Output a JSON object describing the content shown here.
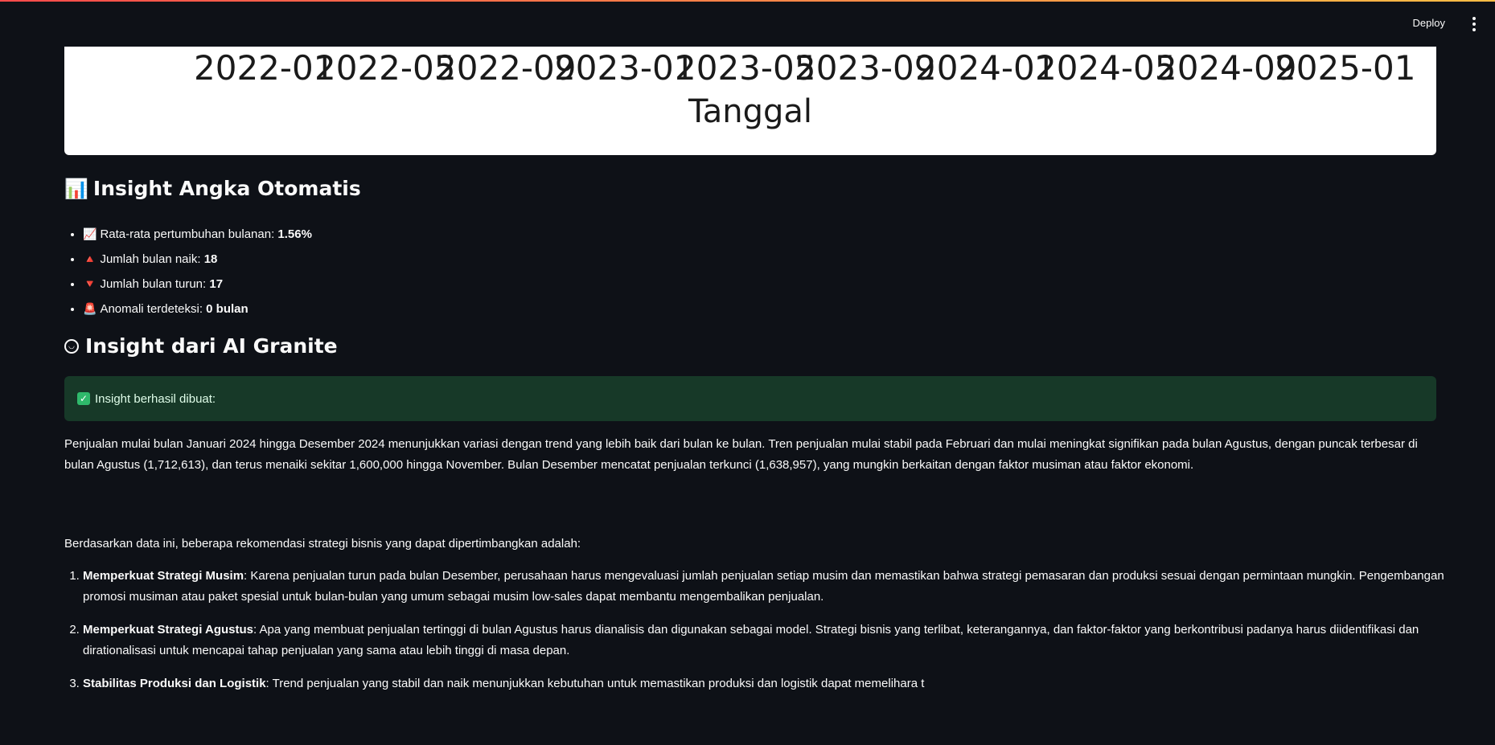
{
  "header": {
    "deploy_label": "Deploy"
  },
  "chart": {
    "tick_labels": [
      "2022-01",
      "2022-05",
      "2022-09",
      "2023-01",
      "2023-05",
      "2023-09",
      "2024-01",
      "2024-05",
      "2024-09",
      "2025-01"
    ],
    "xlabel": "Tanggal"
  },
  "insight_numbers": {
    "title": "Insight Angka Otomatis",
    "items": [
      {
        "emoji": "📈",
        "label": "Rata-rata pertumbuhan bulanan: ",
        "value": "1.56%"
      },
      {
        "emoji": "🔺",
        "label": "Jumlah bulan naik: ",
        "value": "18"
      },
      {
        "emoji": "🔻",
        "label": "Jumlah bulan turun: ",
        "value": "17"
      },
      {
        "emoji": "🚨",
        "label": "Anomali terdeteksi: ",
        "value": "0 bulan"
      }
    ]
  },
  "insight_ai": {
    "title": "Insight dari AI Granite",
    "success_text": "Insight berhasil dibuat:",
    "paragraph1": "Penjualan mulai bulan Januari 2024 hingga Desember 2024 menunjukkan variasi dengan trend yang lebih baik dari bulan ke bulan. Tren penjualan mulai stabil pada Februari dan mulai meningkat signifikan pada bulan Agustus, dengan puncak terbesar di bulan Agustus (1,712,613), dan terus menaiki sekitar 1,600,000 hingga November. Bulan Desember mencatat penjualan terkunci (1,638,957), yang mungkin berkaitan dengan faktor musiman atau faktor ekonomi.",
    "paragraph2": "Berdasarkan data ini, beberapa rekomendasi strategi bisnis yang dapat dipertimbangkan adalah:",
    "recommendations": [
      {
        "title": "Memperkuat Strategi Musim",
        "text": ": Karena penjualan turun pada bulan Desember, perusahaan harus mengevaluasi jumlah penjualan setiap musim dan memastikan bahwa strategi pemasaran dan produksi sesuai dengan permintaan mungkin. Pengembangan promosi musiman atau paket spesial untuk bulan-bulan yang umum sebagai musim low-sales dapat membantu mengembalikan penjualan."
      },
      {
        "title": "Memperkuat Strategi Agustus",
        "text": ": Apa yang membuat penjualan tertinggi di bulan Agustus harus dianalisis dan digunakan sebagai model. Strategi bisnis yang terlibat, keterangannya, dan faktor-faktor yang berkontribusi padanya harus diidentifikasi dan dirationalisasi untuk mencapai tahap penjualan yang sama atau lebih tinggi di masa depan."
      },
      {
        "title": "Stabilitas Produksi dan Logistik",
        "text": ": Trend penjualan yang stabil dan naik menunjukkan kebutuhan untuk memastikan produksi dan logistik dapat memelihara t"
      }
    ]
  }
}
